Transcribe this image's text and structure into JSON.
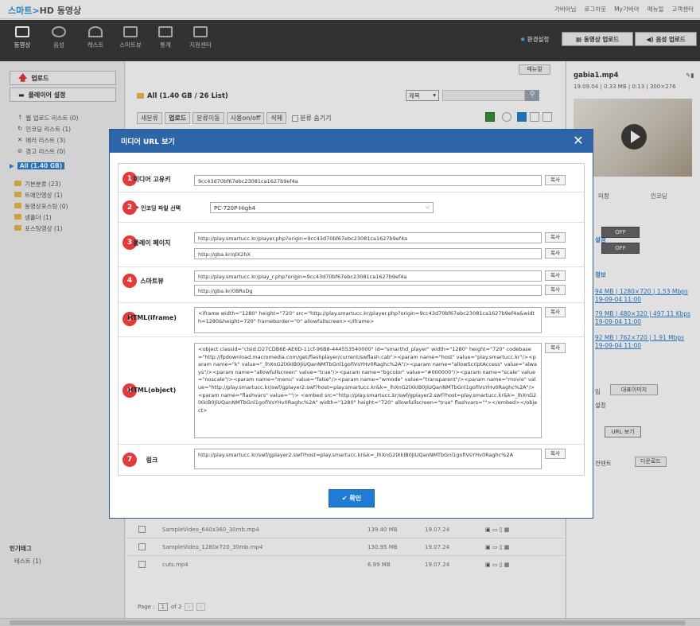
{
  "header": {
    "logo_left": "스마트",
    "logo_right": "HD 동영상",
    "links": [
      "가비아님",
      "로그아웃",
      "My가비아",
      "매뉴얼",
      "고객센터"
    ]
  },
  "nav": {
    "items": [
      "동영상",
      "음성",
      "캐스트",
      "스마트뷰",
      "통계",
      "지원센터"
    ],
    "env": "환경설정",
    "upload_video": "동영상 업로드",
    "upload_audio": "음성 업로드"
  },
  "left": {
    "upload_btn": "업로드",
    "player_btn": "플레이어 설정",
    "lists": [
      "웹 업로드 리스트 (0)",
      "인코딩 리스트 (1)",
      "에러 리스트 (3)",
      "경고 리스트 (0)"
    ],
    "all": "All (1.40 GB)",
    "folders": [
      "기본분류 (23)",
      "트에인영상 (1)",
      "동영상포스팅 (0)",
      "샘플더 (1)",
      "포스팅영상 (1)"
    ],
    "tags_title": "인기태그",
    "tags": "테스트 (1)"
  },
  "main": {
    "manual": "매뉴얼",
    "summary": "All (1.40 GB / 26 List)",
    "select": "제목",
    "toolbar": [
      "새분류",
      "업로드",
      "분류이동",
      "사용on/off",
      "삭제"
    ],
    "hide_cat": "분류 숨기기",
    "rows": [
      {
        "name": "SampleVideo_640x360_30mb.mp4",
        "size": "139.40 MB",
        "date": "19.07.24"
      },
      {
        "name": "SampleVideo_1280x720_30mb.mp4",
        "size": "130.95 MB",
        "date": "19.07.24"
      },
      {
        "name": "cuts.mp4",
        "size": "6.99 MB",
        "date": "19.07.24"
      }
    ],
    "page_label": "Page :",
    "page_num": "1",
    "page_of": "of 2"
  },
  "right": {
    "title": "gabia1.mp4",
    "meta": "19.09.04 | 0.33 MB | 0:13 | 300×276",
    "tab1": "미정",
    "tab2": "인코딩",
    "section1": "설정",
    "toggle": "OFF",
    "section2": "정보",
    "links": [
      "94 MB | 1280×720 | 1.53 Mbps",
      "19-09-04 11:00",
      "79 MB | 480×320 | 497.11 Kbps",
      "19-09-04 11:00",
      "92 MB | 762×720 | 1.91 Mbps",
      "19-09-04 11:00"
    ],
    "img_btn": "대표이미지",
    "edit": "임",
    "setting": "설정",
    "url_btn": "URL 보기",
    "download": "다운로드",
    "content": "컨텐트"
  },
  "modal": {
    "title": "미디어 URL 보기",
    "copy": "복사",
    "ok": "확인",
    "rows": [
      {
        "num": "1",
        "label": "미디어 고유키",
        "values": [
          "9cc43d70bf67ebc23081ca1627b9ef4a"
        ]
      },
      {
        "num": "2",
        "label": "* 인코딩 파일 선택",
        "values": [
          "PC-720P-High4"
        ]
      },
      {
        "num": "3",
        "label": "플레이 페이지",
        "values": [
          "http://play.smartucc.kr/player.php?origin=9cc43d70bf67ebc23081ca1627b9ef4a",
          "http://gba.kr/qlX2hX"
        ]
      },
      {
        "num": "4",
        "label": "스마트뷰",
        "values": [
          "http://play.smartucc.kr/play_r.php?origin=9cc43d70bf67ebc23081ca1627b9ef4a",
          "http://gba.kr/0BRsDg"
        ]
      },
      {
        "num": "5",
        "label": "HTML(iframe)",
        "values": [
          "<iframe width=\"1280\" height=\"720\" src=\"http://play.smartucc.kr/player.php?origin=9cc43d70bf67ebc23081ca1627b9ef4a&width=1280&height=720\" frameborder=\"0\" allowfullscreen></iframe>"
        ]
      },
      {
        "num": "6",
        "label": "HTML(object)",
        "values": [
          "<object classid=\"clsid:D27CDB6E-AE6D-11cf-96B8-444553540000\" id=\"smarthd_player\" width=\"1280\" height=\"720\" codebase=\"http://fpdownload.macromedia.com/get/flashplayer/current/swflash.cab\"><param name=\"host\" value=\"play.smartucc.kr\"/><param name=\"k\" value=\"_lhXnG2lXkIB0JiUQanNMTbGnl1gofiVsYHv0Raghc%2A\"/><param name=\"allowScriptAccess\" value=\"always\"/><param name=\"allowfullscreen\" value=\"true\"/><param name=\"bgcolor\" value=\"#000000\"/><param name=\"scale\" value=\"noscale\"/><param name=\"menu\" value=\"false\"/><param name=\"wmode\" value=\"transparent\"/><param name=\"movie\" value=\"http://play.smartucc.kr/swf/gplayer2.swf?host=play.smartucc.kr&k=_lhXnG2lXkIB0JiUQanNMTbGnl1gofiVsYHv0Raghc%2A\"/><param name=\"flashvars\" value=\"\"/> <embed src=\"http://play.smartucc.kr/swf/gplayer2.swf?host=play.smartucc.kr&k=_lhXnG2lXkIB0JiUQanNMTbGnl1gofiVsYHv0Raghc%2A\" width=\"1280\" height=\"720\" allowfullscreen=\"true\" flashvars=\"\"></embed></object>"
        ]
      },
      {
        "num": "7",
        "label": "링크",
        "values": [
          "http://play.smartucc.kr/swf/gplayer2.swf?host=play.smartucc.kr&k=_lhXnG2lXkIB0JiUQanNMTbGnl1gofiVsYHv0Raghc%2A"
        ]
      }
    ]
  }
}
